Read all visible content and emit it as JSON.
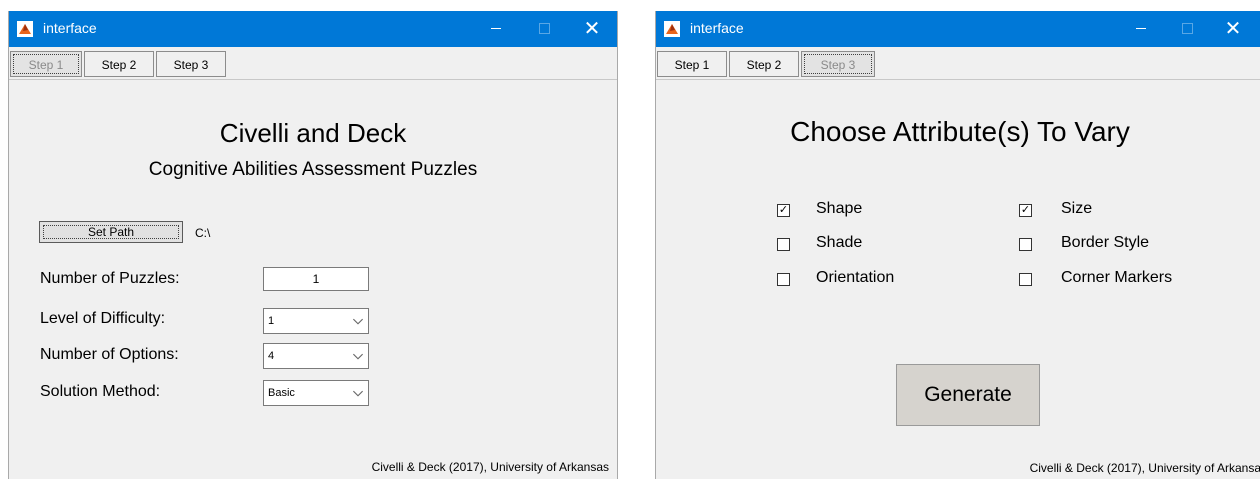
{
  "left_window": {
    "title": "interface",
    "tabs": [
      "Step 1",
      "Step 2",
      "Step 3"
    ],
    "active_tab": "Step 1",
    "heading": "Civelli and Deck",
    "subheading": "Cognitive Abilities Assessment Puzzles",
    "set_path_label": "Set Path",
    "path_value": "C:\\",
    "fields": {
      "num_puzzles_label": "Number of Puzzles:",
      "num_puzzles_value": "1",
      "difficulty_label": "Level of Difficulty:",
      "difficulty_value": "1",
      "options_label": "Number of Options:",
      "options_value": "4",
      "method_label": "Solution Method:",
      "method_value": "Basic"
    },
    "footer": "Civelli & Deck (2017), University of Arkansas"
  },
  "right_window": {
    "title": "interface",
    "tabs": [
      "Step 1",
      "Step 2",
      "Step 3"
    ],
    "active_tab": "Step 3",
    "heading": "Choose Attribute(s) To Vary",
    "attributes": [
      {
        "label": "Shape",
        "checked": true
      },
      {
        "label": "Size",
        "checked": true
      },
      {
        "label": "Shade",
        "checked": false
      },
      {
        "label": "Border Style",
        "checked": false
      },
      {
        "label": "Orientation",
        "checked": false
      },
      {
        "label": "Corner Markers",
        "checked": false
      }
    ],
    "generate_label": "Generate",
    "footer": "Civelli & Deck (2017), University of Arkansas"
  },
  "colors": {
    "titlebar": "#0078d7",
    "panel": "#f0f0f0"
  }
}
